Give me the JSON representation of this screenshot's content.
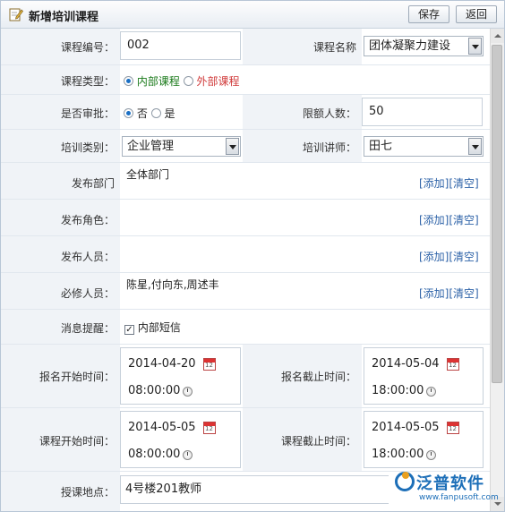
{
  "window": {
    "title": "新增培训课程",
    "save_label": "保存",
    "back_label": "返回"
  },
  "fields": {
    "course_no": {
      "label": "课程编号：",
      "value": "002"
    },
    "course_name": {
      "label": "课程名称",
      "value": "团体凝聚力建设"
    },
    "course_type": {
      "label": "课程类型：",
      "opt_internal": "内部课程",
      "opt_external": "外部课程",
      "selected": "内部课程"
    },
    "approval": {
      "label": "是否审批：",
      "opt_no": "否",
      "opt_yes": "是",
      "selected": "否"
    },
    "quota": {
      "label": "限额人数：",
      "value": "50"
    },
    "category": {
      "label": "培训类别：",
      "value": "企业管理"
    },
    "lecturer": {
      "label": "培训讲师：",
      "value": "田七"
    },
    "publish_dept": {
      "label": "发布部门",
      "value": "全体部门",
      "add": "[添加]",
      "clear": "[清空]"
    },
    "publish_role": {
      "label": "发布角色：",
      "value": "",
      "add": "[添加]",
      "clear": "[清空]"
    },
    "publish_person": {
      "label": "发布人员：",
      "value": "",
      "add": "[添加]",
      "clear": "[清空]"
    },
    "required_person": {
      "label": "必修人员：",
      "value": "陈星,付向东,周述丰",
      "add": "[添加]",
      "clear": "[清空]"
    },
    "reminder": {
      "label": "消息提醒：",
      "option": "内部短信",
      "checked": true
    },
    "enroll_start": {
      "label": "报名开始时间：",
      "date": "2014-04-20",
      "time": "08:00:00"
    },
    "enroll_end": {
      "label": "报名截止时间：",
      "date": "2014-05-04",
      "time": "18:00:00"
    },
    "course_start": {
      "label": "课程开始时间：",
      "date": "2014-05-05",
      "time": "08:00:00"
    },
    "course_end": {
      "label": "课程截止时间：",
      "date": "2014-05-05",
      "time": "18:00:00"
    },
    "location": {
      "label": "授课地点：",
      "value": "4号楼201教师"
    }
  },
  "watermark": {
    "brand": "泛普软件",
    "url": "www.fanpusoft.com"
  },
  "colors": {
    "accent_internal": "#1a7a1a",
    "accent_external": "#d03a3a",
    "link": "#2e63a8",
    "label_bg": "#f0f3f7"
  }
}
